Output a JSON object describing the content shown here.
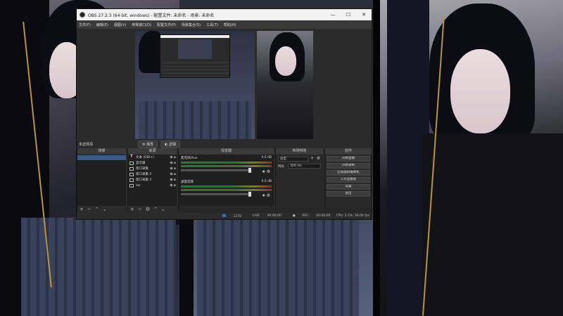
{
  "window": {
    "title": "OBS 27.2.3 (64-bit, windows) - 配置文件: 未命名 - 场景: 未命名",
    "minimize": "—",
    "maximize": "☐",
    "close": "✕"
  },
  "menu": [
    "文件(F)",
    "编辑(E)",
    "视图(V)",
    "停靠窗口(D)",
    "配置文件(P)",
    "场景集合(S)",
    "工具(T)",
    "帮助(H)"
  ],
  "status_row": {
    "scene_label": "未选择源",
    "properties_label": "属性",
    "filters_label": "滤镜"
  },
  "docks": {
    "scenes": "场景",
    "sources": "来源",
    "mixer": "混音器",
    "transitions": "转场特效",
    "controls": "控件"
  },
  "sources": [
    {
      "icon": "T",
      "name": "文本 (GDI+)"
    },
    {
      "icon": "▭",
      "name": "显示器"
    },
    {
      "icon": "▭",
      "name": "窗口采集"
    },
    {
      "icon": "▭",
      "name": "窗口采集 2"
    },
    {
      "icon": "▭",
      "name": "窗口采集 3"
    },
    {
      "icon": "▭",
      "name": "SD"
    }
  ],
  "mixer": [
    {
      "name": "桌面音频",
      "db": "0.0 dB"
    },
    {
      "name": "麦克风/Aux",
      "db": "0.0 dB"
    }
  ],
  "transitions": {
    "type": "淡出",
    "duration_label": "时长",
    "duration_value": "300 ms"
  },
  "controls": [
    "开始直播",
    "开始录制",
    "启动虚拟摄像机",
    "工作室模式",
    "设置",
    "退出"
  ],
  "footer": {
    "live_label": "LIVE:",
    "live_time": "00:00:00",
    "rec_label": "REC:",
    "rec_time": "00:00:00",
    "cpu": "CPU: 2.1%, 30.00 fps",
    "live_value": "1278"
  },
  "colors": {
    "obs_bg": "#2b2b2b",
    "selected_scene": "#3b5b80",
    "button": "#3c3c3c"
  }
}
